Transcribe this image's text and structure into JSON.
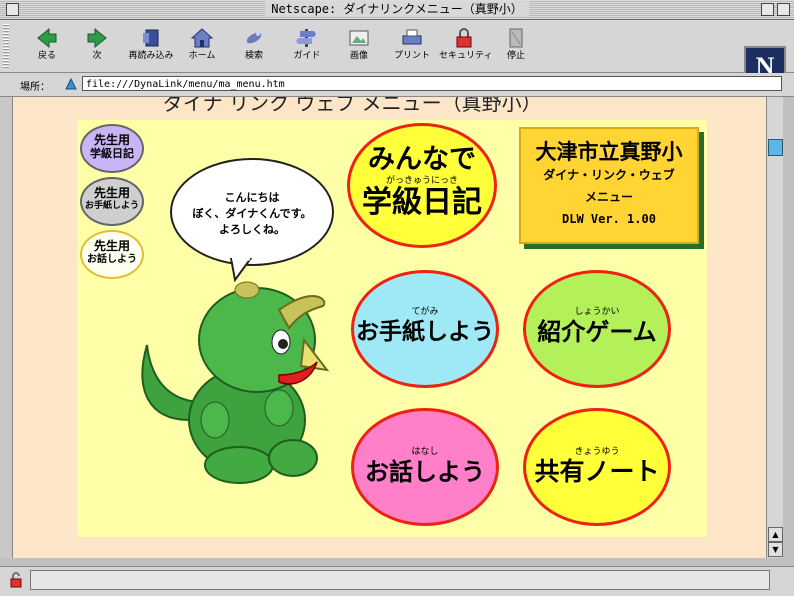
{
  "window": {
    "title": "Netscape: ダイナリンクメニュー（真野小）"
  },
  "toolbar": {
    "buttons": [
      {
        "label": "戻る",
        "icon": "back-arrow-icon"
      },
      {
        "label": "次",
        "icon": "forward-arrow-icon"
      },
      {
        "label": "再読み込み",
        "icon": "reload-icon"
      },
      {
        "label": "ホーム",
        "icon": "home-icon"
      },
      {
        "label": "検索",
        "icon": "search-icon"
      },
      {
        "label": "ガイド",
        "icon": "guide-icon"
      },
      {
        "label": "画像",
        "icon": "images-icon"
      },
      {
        "label": "プリント",
        "icon": "printer-icon"
      },
      {
        "label": "セキュリティ",
        "icon": "padlock-icon"
      },
      {
        "label": "停止",
        "icon": "stop-icon"
      }
    ],
    "logo": "N"
  },
  "location": {
    "label": "場所：",
    "url": "file:///DynaLink/menu/ma_menu.htm"
  },
  "page": {
    "heading": "ダイナ リンク ウェブ メニュー（真野小）",
    "teacher_buttons": [
      {
        "line1": "先生用",
        "line2": "学級日記",
        "color": "#c9b4f5"
      },
      {
        "line1": "先生用",
        "line2": "お手紙しよう",
        "color": "#cfcfcf"
      },
      {
        "line1": "先生用",
        "line2": "お話しよう",
        "color": "#fffff0"
      }
    ],
    "speech": [
      "こんにちは",
      "ぼく、ダイナくんです。",
      "よろしくね。"
    ],
    "menu": [
      {
        "top": "みんなで",
        "ruby": "がっきゅうにっき",
        "main": "学級日記",
        "color": "#ffff3a"
      },
      {
        "ruby": "てがみ",
        "main": "お手紙しよう",
        "color": "#9fe8f5"
      },
      {
        "ruby": "しょうかい",
        "main": "紹介ゲーム",
        "color": "#b4f05a"
      },
      {
        "ruby": "はなし",
        "main": "お話しよう",
        "color": "#ff7fc8"
      },
      {
        "ruby": "きょうゆう",
        "main": "共有ノート",
        "color": "#ffff3a"
      }
    ],
    "info": {
      "school": "大津市立真野小",
      "app": "ダイナ・リンク・ウェブ",
      "menu": "メニュー",
      "version": "DLW Ver. 1.00"
    }
  },
  "colors": {
    "panel": "#ffffa8",
    "page_bg": "#fde6c8",
    "oval_border": "#e21",
    "dino": "#3ea23e"
  }
}
